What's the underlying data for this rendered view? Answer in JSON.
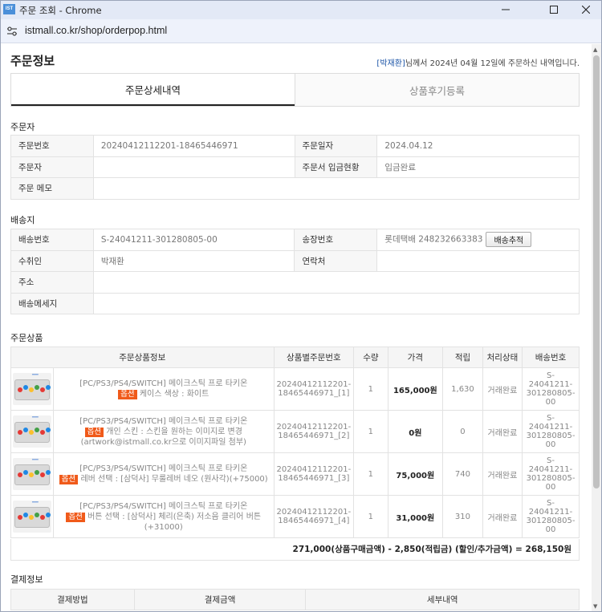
{
  "window": {
    "app_icon": "IST",
    "title": "주문 조회 - Chrome",
    "url": "istmall.co.kr/shop/orderpop.html"
  },
  "page": {
    "title": "주문정보",
    "notice": {
      "name": "[박재환]",
      "text": "님께서 2024년 04월 12일에 주문하신 내역입니다."
    },
    "tabs": [
      "주문상세내역",
      "상품후기등록"
    ]
  },
  "orderer": {
    "section": "주문자",
    "order_no_label": "주문번호",
    "order_no": "20240412112201-18465446971",
    "order_date_label": "주문일자",
    "order_date": "2024.04.12",
    "name_label": "주문자",
    "name": "",
    "deposit_label": "주문서 입금현황",
    "deposit": "입금완료",
    "memo_label": "주문 메모",
    "memo": ""
  },
  "shipping": {
    "section": "배송지",
    "ship_no_label": "배송번호",
    "ship_no": "S-24041211-301280805-00",
    "invoice_label": "송장번호",
    "invoice": "롯데택배 248232663383",
    "track_button": "배송추적",
    "receiver_label": "수취인",
    "receiver": "박재환",
    "contact_label": "연락처",
    "contact": "",
    "address_label": "주소",
    "address": "",
    "message_label": "배송메세지",
    "message": ""
  },
  "products": {
    "section": "주문상품",
    "headers": [
      "주문상품정보",
      "상품별주문번호",
      "수량",
      "가격",
      "적립",
      "처리상태",
      "배송번호"
    ],
    "option_badge": "옵션",
    "rows": [
      {
        "name": "[PC/PS3/PS4/SWITCH] 메이크스틱 프로 타키온",
        "option": "케이스 색상 : 화이트",
        "order_no": "20240412112201-18465446971_[1]",
        "qty": "1",
        "price": "165,000원",
        "points": "1,630",
        "status": "거래완료",
        "ship_no": "S-24041211-301280805-00"
      },
      {
        "name": "[PC/PS3/PS4/SWITCH] 메이크스틱 프로 타키온",
        "option": "개인 스킨 : 스킨을 원하는 이미지로 변경 (artwork@istmall.co.kr으로 이미지파일 첨부)",
        "order_no": "20240412112201-18465446971_[2]",
        "qty": "1",
        "price": "0원",
        "points": "0",
        "status": "거래완료",
        "ship_no": "S-24041211-301280805-00"
      },
      {
        "name": "[PC/PS3/PS4/SWITCH] 메이크스틱 프로 타키온",
        "option": "레버 선택 : [삼덕사] 무룰레버 네오 (원사각)(+75000)",
        "order_no": "20240412112201-18465446971_[3]",
        "qty": "1",
        "price": "75,000원",
        "points": "740",
        "status": "거래완료",
        "ship_no": "S-24041211-301280805-00"
      },
      {
        "name": "[PC/PS3/PS4/SWITCH] 메이크스틱 프로 타키온",
        "option": "버튼 선택 : [삼덕사] 체리(은축) 저소음 클리어 버튼 (+31000)",
        "order_no": "20240412112201-18465446971_[4]",
        "qty": "1",
        "price": "31,000원",
        "points": "310",
        "status": "거래완료",
        "ship_no": "S-24041211-301280805-00"
      }
    ],
    "total": "271,000(상품구매금액) - 2,850(적립금) (할인/추가금액) = 268,150원"
  },
  "payment": {
    "section": "결제정보",
    "headers": [
      "결제방법",
      "결제금액",
      "세부내역"
    ]
  },
  "colors": {
    "option_badge": "#f05a1a",
    "notice_name": "#1f57a8",
    "title_bar": "#e3e9f6"
  }
}
